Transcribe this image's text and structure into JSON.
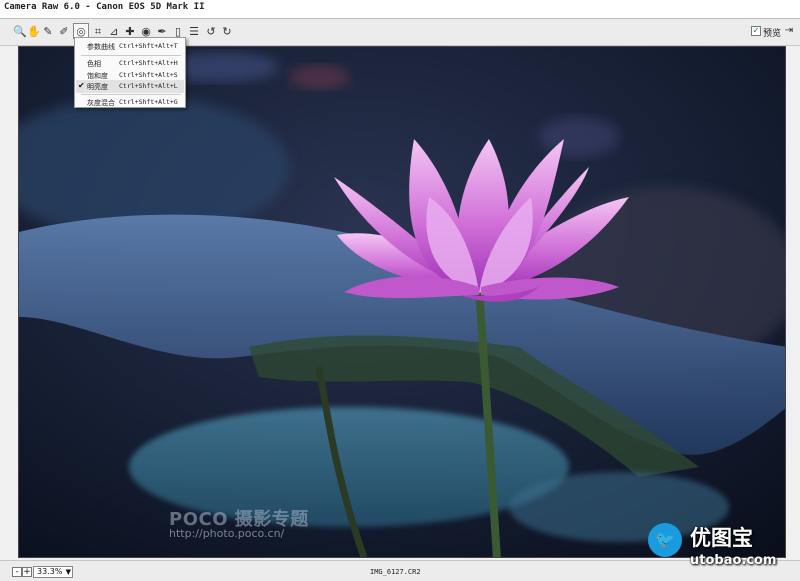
{
  "window": {
    "title": "Camera Raw 6.0 -  Canon EOS 5D Mark II"
  },
  "toolbar": {
    "tools": [
      {
        "name": "zoom-tool-icon",
        "glyph": "🔍"
      },
      {
        "name": "hand-tool-icon",
        "glyph": "✋"
      },
      {
        "name": "white-balance-tool-icon",
        "glyph": "✎"
      },
      {
        "name": "color-sampler-tool-icon",
        "glyph": "✐"
      },
      {
        "name": "targeted-adjustment-tool-icon",
        "glyph": "◎"
      },
      {
        "name": "crop-tool-icon",
        "glyph": "⌗"
      },
      {
        "name": "straighten-tool-icon",
        "glyph": "⊿"
      },
      {
        "name": "spot-removal-tool-icon",
        "glyph": "✚"
      },
      {
        "name": "red-eye-tool-icon",
        "glyph": "◉"
      },
      {
        "name": "adjustment-brush-icon",
        "glyph": "✒"
      },
      {
        "name": "graduated-filter-icon",
        "glyph": "▯"
      },
      {
        "name": "preferences-icon",
        "glyph": "☰"
      },
      {
        "name": "rotate-left-icon",
        "glyph": "↺"
      },
      {
        "name": "rotate-right-icon",
        "glyph": "↻"
      }
    ],
    "preview_label": "预览",
    "preview_checked": true
  },
  "menu": {
    "items": [
      {
        "label": "参数曲线",
        "shortcut": "Ctrl+Shft+Alt+T",
        "checked": false
      },
      {
        "label": "色相",
        "shortcut": "Ctrl+Shft+Alt+H",
        "checked": false
      },
      {
        "label": "饱和度",
        "shortcut": "Ctrl+Shft+Alt+S",
        "checked": false
      },
      {
        "label": "明亮度",
        "shortcut": "Ctrl+Shft+Alt+L",
        "checked": true
      },
      {
        "label": "灰度混合",
        "shortcut": "Ctrl+Shft+Alt+G",
        "checked": false
      }
    ]
  },
  "status": {
    "zoom_minus": "-",
    "zoom_plus": "+",
    "zoom": "33.3%",
    "filename": "IMG_6127.CR2"
  },
  "watermark": {
    "brand": "POCO 摄影专题",
    "url": "http://photo.poco.cn/"
  },
  "site_logo": {
    "text": "优图宝",
    "url": "utobao.com"
  },
  "colors": {
    "petal": "#d070d8",
    "petal_dark": "#a030b8",
    "leaf": "#3a5a88",
    "background": "#0b1220"
  }
}
